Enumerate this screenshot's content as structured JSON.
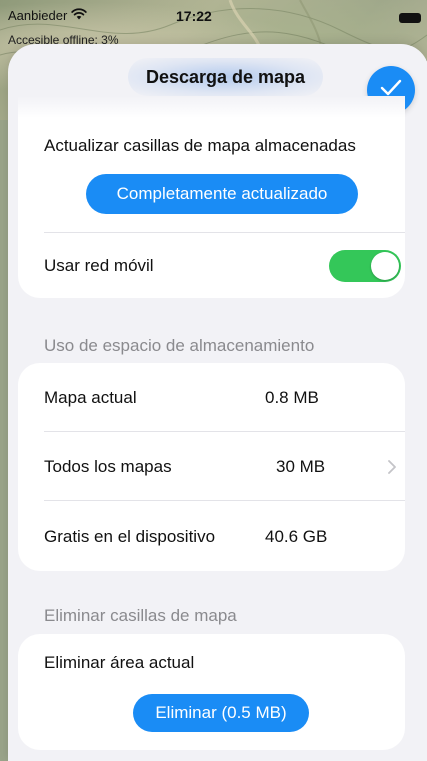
{
  "status_bar": {
    "carrier": "Aanbieder",
    "time": "17:22",
    "offline_text": "Accesible offline: 3%"
  },
  "sheet": {
    "title": "Descarga de mapa"
  },
  "update_section": {
    "label": "Actualizar casillas de mapa almacenadas",
    "button_label": "Completamente actualizado",
    "mobile_network_label": "Usar red móvil",
    "mobile_network_enabled": true
  },
  "storage_section": {
    "header": "Uso de espacio de almacenamiento",
    "rows": [
      {
        "label": "Mapa actual",
        "value": "0.8 MB"
      },
      {
        "label": "Todos los mapas",
        "value": "30 MB"
      },
      {
        "label": "Gratis en el dispositivo",
        "value": "40.6 GB"
      }
    ]
  },
  "delete_section": {
    "header": "Eliminar casillas de mapa",
    "label": "Eliminar área actual",
    "button_label": "Eliminar (0.5 MB)"
  },
  "colors": {
    "accent": "#1a8cf5",
    "toggle_on": "#34c759",
    "background": "#f2f2f6",
    "secondary_text": "#8a8a8e"
  },
  "icons": [
    "wifi-icon",
    "battery-icon",
    "checkmark-icon",
    "chevron-right-icon"
  ]
}
